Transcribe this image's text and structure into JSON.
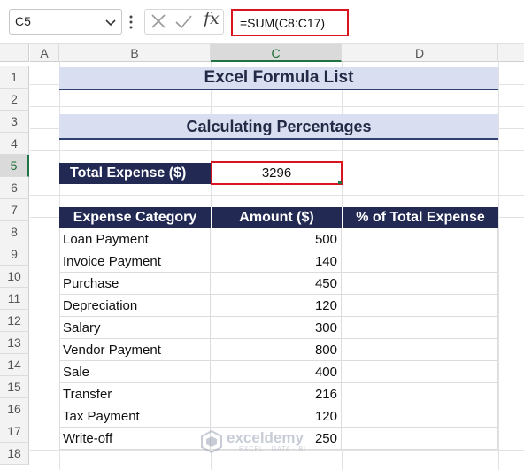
{
  "formula_bar": {
    "name_box": "C5",
    "fx_label": "fx",
    "formula": "=SUM(C8:C17)"
  },
  "columns": [
    "A",
    "B",
    "C",
    "D"
  ],
  "rows": [
    "1",
    "2",
    "3",
    "4",
    "5",
    "6",
    "7",
    "8",
    "9",
    "10",
    "11",
    "12",
    "13",
    "14",
    "15",
    "16",
    "17",
    "18"
  ],
  "sheet": {
    "title": "Excel Formula List",
    "subtitle": "Calculating Percentages",
    "total_label": "Total Expense ($)",
    "total_value": "3296",
    "headers": [
      "Expense Category",
      "Amount ($)",
      "% of Total Expense"
    ],
    "rows": [
      {
        "category": "Loan Payment",
        "amount": "500",
        "pct": ""
      },
      {
        "category": "Invoice Payment",
        "amount": "140",
        "pct": ""
      },
      {
        "category": "Purchase",
        "amount": "450",
        "pct": ""
      },
      {
        "category": "Depreciation",
        "amount": "120",
        "pct": ""
      },
      {
        "category": "Salary",
        "amount": "300",
        "pct": ""
      },
      {
        "category": "Vendor Payment",
        "amount": "800",
        "pct": ""
      },
      {
        "category": "Sale",
        "amount": "400",
        "pct": ""
      },
      {
        "category": "Transfer",
        "amount": "216",
        "pct": ""
      },
      {
        "category": "Tax Payment",
        "amount": "120",
        "pct": ""
      },
      {
        "category": "Write-off",
        "amount": "250",
        "pct": ""
      }
    ]
  },
  "watermark": {
    "name": "exceldemy",
    "tagline": "EXCEL · DATA · BI"
  },
  "colors": {
    "header_fill": "#222a54",
    "title_fill": "#d9dff0",
    "highlight": "#d9141f",
    "excel_green": "#217346"
  }
}
